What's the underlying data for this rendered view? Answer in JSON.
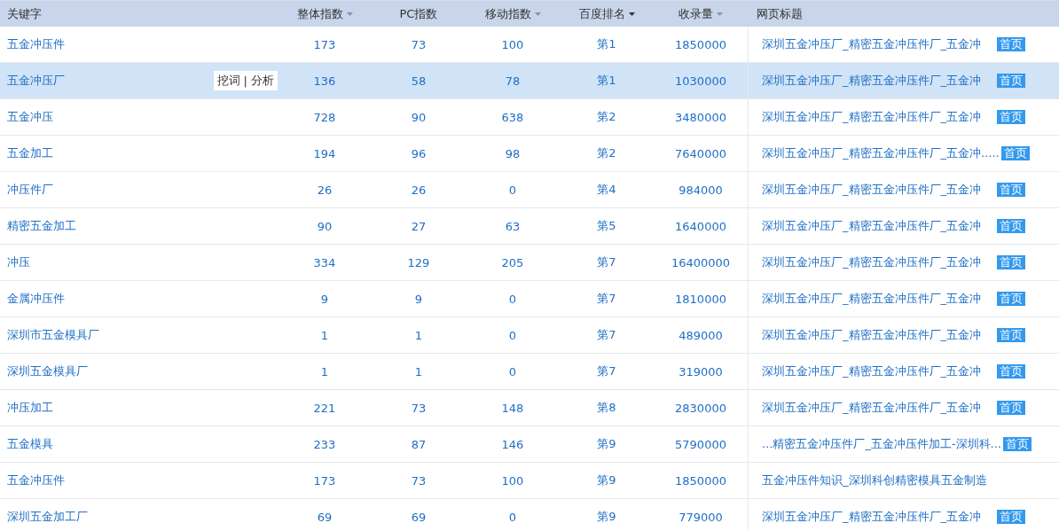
{
  "table": {
    "columns": [
      {
        "label": "关键字",
        "kind": "plain",
        "selected": false
      },
      {
        "label": "整体指数",
        "kind": "sortable",
        "selected": false
      },
      {
        "label": "PC指数",
        "kind": "plain",
        "selected": false
      },
      {
        "label": "移动指数",
        "kind": "sortable",
        "selected": false
      },
      {
        "label": "百度排名",
        "kind": "sortable",
        "selected": true
      },
      {
        "label": "收录量",
        "kind": "sortable",
        "selected": false
      },
      {
        "label": "网页标题",
        "kind": "plain",
        "selected": false
      }
    ],
    "row_actions": [
      {
        "label": "挖词"
      },
      {
        "label": "分析"
      }
    ],
    "action_separator": "|",
    "rows": [
      {
        "keyword": "五金冲压件",
        "overall": "173",
        "pc": "73",
        "mobile": "100",
        "rank": "第1",
        "indexed": "1850000",
        "title": "深圳五金冲压厂_精密五金冲压件厂_五金冲",
        "badge": "首页",
        "selected": false
      },
      {
        "keyword": "五金冲压厂",
        "overall": "136",
        "pc": "58",
        "mobile": "78",
        "rank": "第1",
        "indexed": "1030000",
        "title": "深圳五金冲压厂_精密五金冲压件厂_五金冲",
        "badge": "首页",
        "selected": true
      },
      {
        "keyword": "五金冲压",
        "overall": "728",
        "pc": "90",
        "mobile": "638",
        "rank": "第2",
        "indexed": "3480000",
        "title": "深圳五金冲压厂_精密五金冲压件厂_五金冲",
        "badge": "首页",
        "selected": false
      },
      {
        "keyword": "五金加工",
        "overall": "194",
        "pc": "96",
        "mobile": "98",
        "rank": "第2",
        "indexed": "7640000",
        "title": "深圳五金冲压厂_精密五金冲压件厂_五金冲.....",
        "badge": "首页",
        "selected": false
      },
      {
        "keyword": "冲压件厂",
        "overall": "26",
        "pc": "26",
        "mobile": "0",
        "rank": "第4",
        "indexed": "984000",
        "title": "深圳五金冲压厂_精密五金冲压件厂_五金冲",
        "badge": "首页",
        "selected": false
      },
      {
        "keyword": "精密五金加工",
        "overall": "90",
        "pc": "27",
        "mobile": "63",
        "rank": "第5",
        "indexed": "1640000",
        "title": "深圳五金冲压厂_精密五金冲压件厂_五金冲",
        "badge": "首页",
        "selected": false
      },
      {
        "keyword": "冲压",
        "overall": "334",
        "pc": "129",
        "mobile": "205",
        "rank": "第7",
        "indexed": "16400000",
        "title": "深圳五金冲压厂_精密五金冲压件厂_五金冲",
        "badge": "首页",
        "selected": false
      },
      {
        "keyword": "金属冲压件",
        "overall": "9",
        "pc": "9",
        "mobile": "0",
        "rank": "第7",
        "indexed": "1810000",
        "title": "深圳五金冲压厂_精密五金冲压件厂_五金冲",
        "badge": "首页",
        "selected": false
      },
      {
        "keyword": "深圳市五金模具厂",
        "overall": "1",
        "pc": "1",
        "mobile": "0",
        "rank": "第7",
        "indexed": "489000",
        "title": "深圳五金冲压厂_精密五金冲压件厂_五金冲",
        "badge": "首页",
        "selected": false
      },
      {
        "keyword": "深圳五金模具厂",
        "overall": "1",
        "pc": "1",
        "mobile": "0",
        "rank": "第7",
        "indexed": "319000",
        "title": "深圳五金冲压厂_精密五金冲压件厂_五金冲",
        "badge": "首页",
        "selected": false
      },
      {
        "keyword": "冲压加工",
        "overall": "221",
        "pc": "73",
        "mobile": "148",
        "rank": "第8",
        "indexed": "2830000",
        "title": "深圳五金冲压厂_精密五金冲压件厂_五金冲",
        "badge": "首页",
        "selected": false
      },
      {
        "keyword": "五金模具",
        "overall": "233",
        "pc": "87",
        "mobile": "146",
        "rank": "第9",
        "indexed": "5790000",
        "title": "...精密五金冲压件厂_五金冲压件加工-深圳科...",
        "badge": "首页",
        "selected": false
      },
      {
        "keyword": "五金冲压件",
        "overall": "173",
        "pc": "73",
        "mobile": "100",
        "rank": "第9",
        "indexed": "1850000",
        "title": "五金冲压件知识_深圳科创精密模具五金制造",
        "selected": false
      },
      {
        "keyword": "深圳五金加工厂",
        "overall": "69",
        "pc": "69",
        "mobile": "0",
        "rank": "第9",
        "indexed": "779000",
        "title": "深圳五金冲压厂_精密五金冲压件厂_五金冲",
        "badge": "首页",
        "selected": false
      }
    ]
  }
}
